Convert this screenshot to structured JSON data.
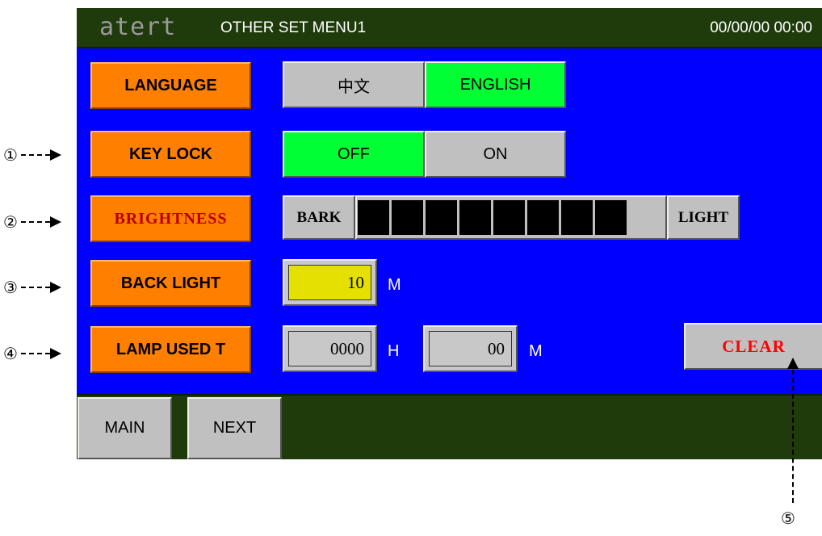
{
  "header": {
    "logo": "atert",
    "title": "OTHER SET MENU1",
    "clock": "00/00/00 00:00"
  },
  "settings": {
    "language": {
      "label": "LANGUAGE",
      "option_cn": "中文",
      "option_en": "ENGLISH",
      "selected": "ENGLISH"
    },
    "key_lock": {
      "label": "KEY LOCK",
      "option_off": "OFF",
      "option_on": "ON",
      "selected": "OFF"
    },
    "brightness": {
      "label": "BRIGHTNESS",
      "low_label": "BARK",
      "high_label": "LIGHT",
      "level": 8,
      "max": 9
    },
    "back_light": {
      "label": "BACK LIGHT",
      "value": "10",
      "unit": "M"
    },
    "lamp_used": {
      "label": "LAMP USED T",
      "hours": "0000",
      "hours_unit": "H",
      "minutes": "00",
      "minutes_unit": "M",
      "clear_label": "CLEAR"
    }
  },
  "footer": {
    "main_label": "MAIN",
    "next_label": "NEXT"
  },
  "callouts": {
    "c1": "①",
    "c2": "②",
    "c3": "③",
    "c4": "④",
    "c5": "⑤"
  },
  "colors": {
    "panel": "#0000ff",
    "header": "#1f3a0b",
    "label_button": "#ff7f00",
    "selected": "#00ff33",
    "field_highlight": "#e6e000",
    "clear_text": "#ff0000"
  }
}
